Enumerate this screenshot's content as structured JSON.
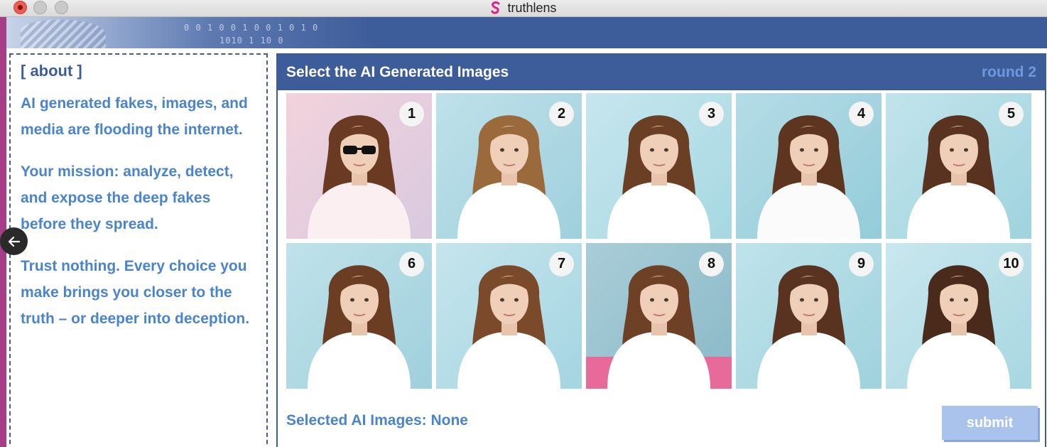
{
  "window": {
    "title": "truthlens",
    "logo_icon": "truthlens-logo-icon",
    "logo_color": "#e0208a"
  },
  "banner": {
    "binary_line_1": "0  0 1 0  0 1 0   0 1   0 1 0",
    "binary_line_2": "1010    1   10   0"
  },
  "about": {
    "heading": "[ about ]",
    "paragraphs": [
      "AI generated fakes, images, and media are flooding the internet.",
      "Your mission: analyze, detect, and expose the deep fakes before they spread.",
      "Trust nothing. Every choice you make brings you closer to the truth – or deeper into deception."
    ]
  },
  "nav": {
    "back_icon": "arrow-left-icon"
  },
  "game": {
    "title": "Select the AI Generated Images",
    "round": "round 2",
    "images": [
      {
        "number": "1"
      },
      {
        "number": "2"
      },
      {
        "number": "3"
      },
      {
        "number": "4"
      },
      {
        "number": "5"
      },
      {
        "number": "6"
      },
      {
        "number": "7"
      },
      {
        "number": "8"
      },
      {
        "number": "9"
      },
      {
        "number": "10"
      }
    ],
    "selected_label": "Selected AI Images: None",
    "submit_label": "submit"
  },
  "colors": {
    "accent": "#3d5c9a",
    "text_blue": "#4a84cc",
    "submit_disabled": "#a9c3ec",
    "background": "#a63d87"
  }
}
